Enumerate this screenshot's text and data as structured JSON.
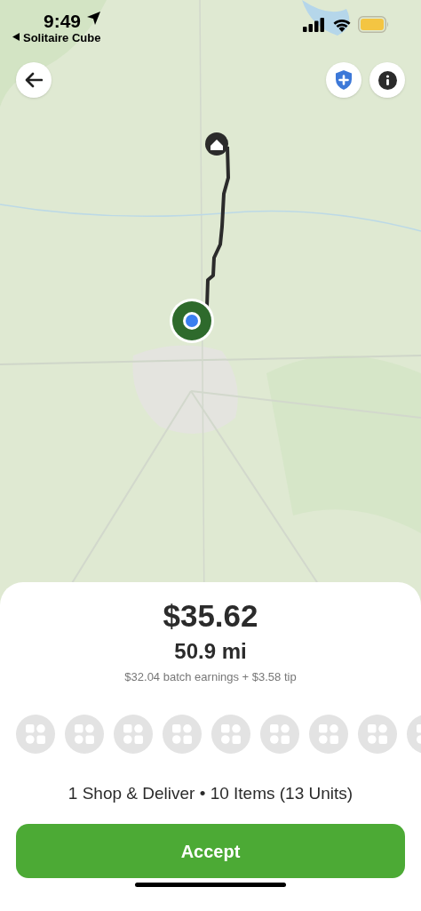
{
  "status_bar": {
    "time": "9:49",
    "back_app": "Solitaire Cube"
  },
  "offer": {
    "amount": "$35.62",
    "distance": "50.9 mi",
    "breakdown": "$32.04 batch earnings + $3.58 tip",
    "items": [
      {
        "kind": "placeholder"
      },
      {
        "kind": "placeholder"
      },
      {
        "kind": "placeholder"
      },
      {
        "kind": "placeholder"
      },
      {
        "kind": "placeholder"
      },
      {
        "kind": "placeholder"
      },
      {
        "kind": "placeholder"
      },
      {
        "kind": "placeholder"
      },
      {
        "kind": "placeholder"
      }
    ],
    "summary": "1 Shop & Deliver • 10 Items (13 Units)"
  },
  "accept_button": "Accept"
}
